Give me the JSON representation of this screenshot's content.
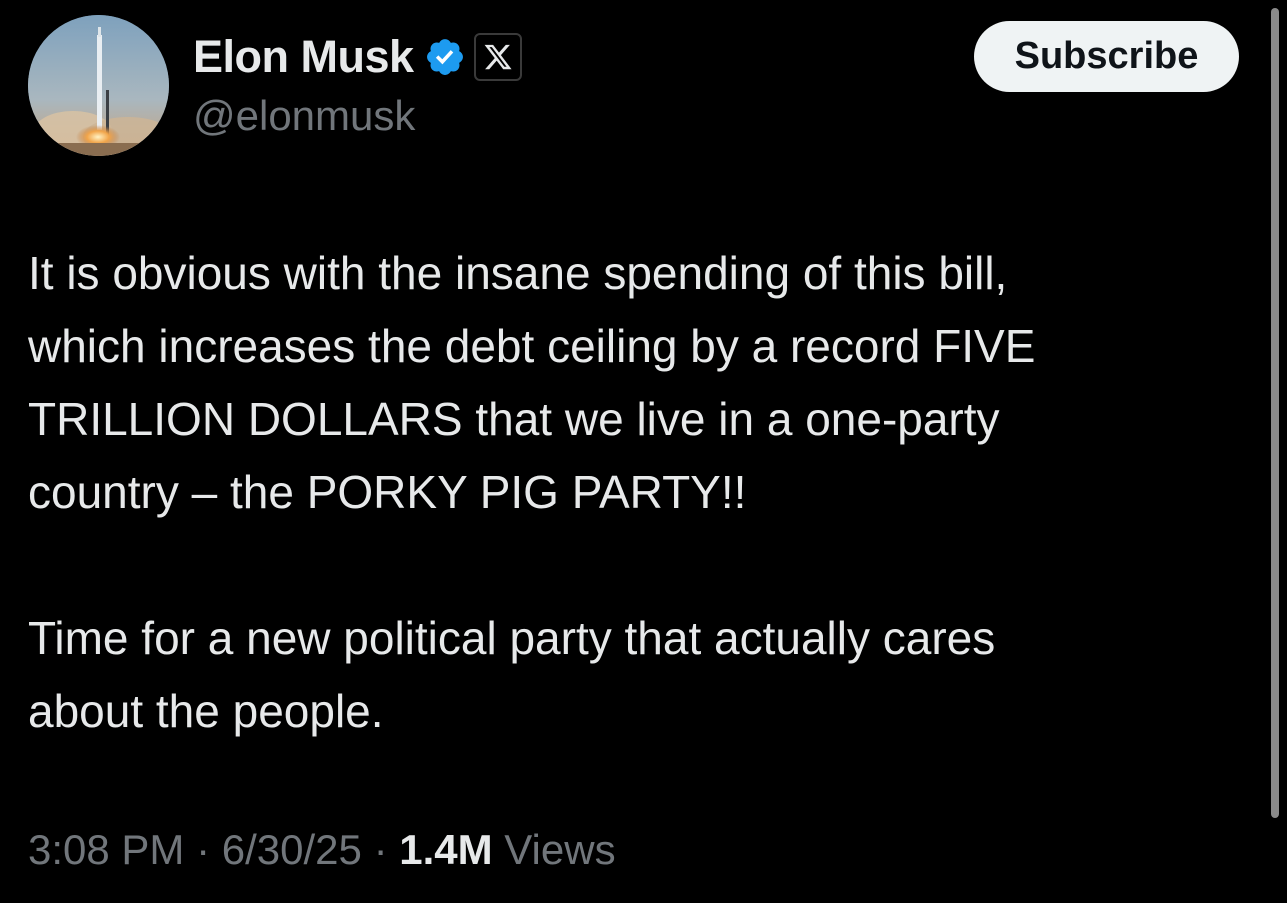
{
  "author": {
    "display_name": "Elon Musk",
    "handle": "@elonmusk",
    "verified_icon": "verified-badge-icon",
    "affiliate_icon": "x-logo-icon",
    "avatar_desc": "rocket-launch"
  },
  "actions": {
    "subscribe_label": "Subscribe"
  },
  "tweet": {
    "paragraph_1": "It is obvious with the insane spending of this bill,\nwhich increases the debt ceiling by a record FIVE\nTRILLION DOLLARS that we live in a one-party\ncountry – the PORKY PIG PARTY!!",
    "paragraph_2": "Time for a new political party that actually cares\nabout the people."
  },
  "meta": {
    "time": "3:08 PM",
    "separator": "·",
    "date": "6/30/25",
    "views_count": "1.4M",
    "views_label": "Views"
  },
  "colors": {
    "background": "#000000",
    "primary_text": "#e7e9ea",
    "secondary_text": "#71767b",
    "verified_blue": "#1d9bf0",
    "subscribe_bg": "#eff3f4"
  }
}
